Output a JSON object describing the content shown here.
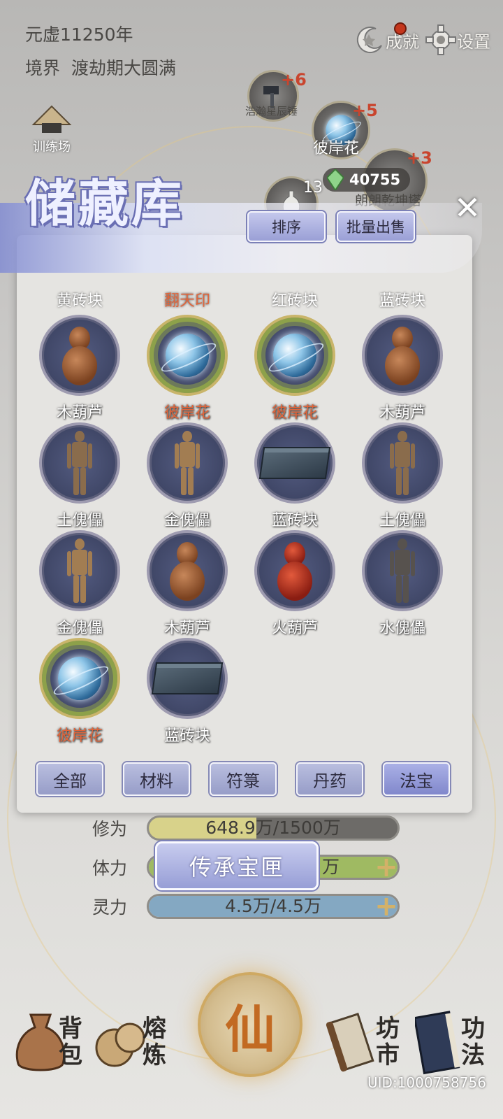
{
  "top": {
    "year": "元虚11250年",
    "realm_label": "境界",
    "realm_value": "渡劫期大圆满",
    "achievements_label": "成就",
    "settings_label": "设置",
    "training_label": "训练场"
  },
  "map_nodes": [
    {
      "label": "浩瀚星辰锤",
      "bonus": "+6"
    },
    {
      "label": "彼岸花",
      "bonus": "+5"
    },
    {
      "label": "朗朗乾坤塔",
      "bonus": "+3"
    },
    {
      "label": "",
      "bonus": "13"
    }
  ],
  "currency": {
    "crystals": "40755"
  },
  "storage": {
    "title": "储藏库",
    "sort_label": "排序",
    "bulk_sell_label": "批量出售",
    "partial_row": [
      {
        "name": "黄砖块",
        "rare": false
      },
      {
        "name": "翻天印",
        "rare": true
      },
      {
        "name": "红砖块",
        "rare": false
      },
      {
        "name": "蓝砖块",
        "rare": false
      }
    ],
    "items": [
      {
        "name": "木葫芦",
        "icon": "wood-gourd",
        "rare": false
      },
      {
        "name": "彼岸花",
        "icon": "spirit-orb",
        "rare": true
      },
      {
        "name": "彼岸花",
        "icon": "spirit-orb",
        "rare": true
      },
      {
        "name": "木葫芦",
        "icon": "wood-gourd",
        "rare": false
      },
      {
        "name": "土傀儡",
        "icon": "earth-puppet",
        "rare": false
      },
      {
        "name": "金傀儡",
        "icon": "gold-puppet",
        "rare": false
      },
      {
        "name": "蓝砖块",
        "icon": "blue-brick",
        "rare": false
      },
      {
        "name": "土傀儡",
        "icon": "earth-puppet",
        "rare": false
      },
      {
        "name": "金傀儡",
        "icon": "gold-puppet",
        "rare": false
      },
      {
        "name": "木葫芦",
        "icon": "wood-gourd",
        "rare": false
      },
      {
        "name": "火葫芦",
        "icon": "fire-gourd",
        "rare": false
      },
      {
        "name": "水傀儡",
        "icon": "water-puppet",
        "rare": false
      },
      {
        "name": "彼岸花",
        "icon": "spirit-orb",
        "rare": true
      },
      {
        "name": "蓝砖块",
        "icon": "blue-brick",
        "rare": false
      }
    ],
    "tabs": [
      "全部",
      "材料",
      "符箓",
      "丹药",
      "法宝"
    ],
    "active_tab": "法宝"
  },
  "stats": {
    "cultivation_label": "修为",
    "cultivation_value": "648.9万/1500万",
    "cultivation_fraction": 0.4326,
    "stamina_label": "体力",
    "stamina_value_tail": "万",
    "spirit_label": "灵力",
    "spirit_value": "4.5万/4.5万",
    "spirit_fraction": 1.0
  },
  "inheritance_button": "传承宝匣",
  "nav": {
    "bag": "背包",
    "smelt": "熔炼",
    "xian": "仙",
    "market": "坊市",
    "skills": "功法"
  },
  "uid": "UID:1000758756",
  "colors": {
    "rare_text": "#e0653b",
    "button_blue": "#979dc8",
    "cultivation_bar": "#d8d28a",
    "stamina_bar": "#9fba62",
    "spirit_bar": "#84a8c2"
  }
}
